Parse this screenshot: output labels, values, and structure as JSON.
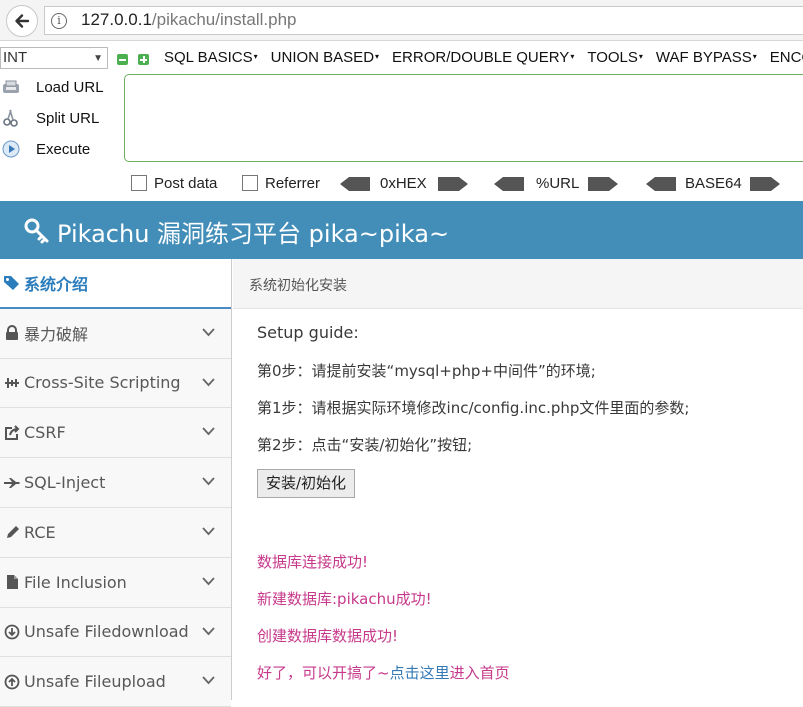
{
  "browser": {
    "url_host": "127.0.0.1",
    "url_path": "/pikachu/install.php"
  },
  "hackbar": {
    "type_select": "INT",
    "menu": [
      "SQL BASICS",
      "UNION BASED",
      "ERROR/DOUBLE QUERY",
      "TOOLS",
      "WAF BYPASS",
      "ENCO"
    ],
    "actions": {
      "load": "Load URL",
      "split": "Split URL",
      "execute": "Execute"
    },
    "url_value": "",
    "options": {
      "post_data": "Post data",
      "referrer": "Referrer",
      "hex": "0xHEX",
      "urlenc": "%URL",
      "base64": "BASE64"
    }
  },
  "header": {
    "title": "Pikachu 漏洞练习平台 pika~pika~"
  },
  "sidebar": {
    "items": [
      {
        "label": "系统介绍",
        "icon": "tag-icon",
        "active": true
      },
      {
        "label": "暴力破解",
        "icon": "lock-icon"
      },
      {
        "label": "Cross-Site Scripting",
        "icon": "xss-icon"
      },
      {
        "label": "CSRF",
        "icon": "share-icon"
      },
      {
        "label": "SQL-Inject",
        "icon": "fighter-jet-icon"
      },
      {
        "label": "RCE",
        "icon": "pencil-icon"
      },
      {
        "label": "File Inclusion",
        "icon": "file-icon"
      },
      {
        "label": "Unsafe Filedownload",
        "icon": "download-icon"
      },
      {
        "label": "Unsafe Fileupload",
        "icon": "upload-icon"
      }
    ]
  },
  "breadcrumb": "系统初始化安装",
  "guide": {
    "title": "Setup guide:",
    "step0": "第0步：请提前安装“mysql+php+中间件”的环境;",
    "step1": "第1步：请根据实际环境修改inc/config.inc.php文件里面的参数;",
    "step2": "第2步：点击“安装/初始化”按钮;",
    "button": "安装/初始化"
  },
  "messages": {
    "m1": "数据库连接成功!",
    "m2": "新建数据库:pikachu成功!",
    "m3": "创建数据库数据成功!",
    "m4_prefix": "好了，可以开搞了~",
    "m4_link": "点击这里",
    "m4_suffix": "进入首页"
  },
  "colors": {
    "header": "#438eb9",
    "message": "#c7398b",
    "link": "#337ab7",
    "active_nav": "#2b7dbc"
  }
}
